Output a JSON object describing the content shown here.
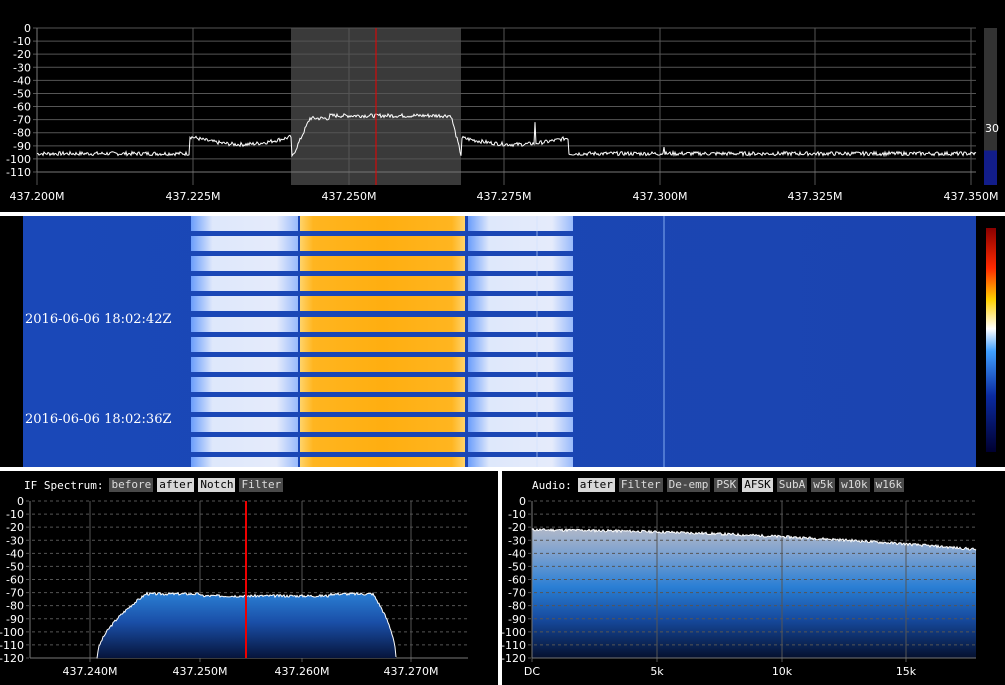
{
  "top_spectrum": {
    "y_ticks": [
      "0",
      "-10",
      "-20",
      "-30",
      "-40",
      "-50",
      "-60",
      "-70",
      "-80",
      "-90",
      "-100",
      "-110"
    ],
    "x_ticks": [
      "437.200M",
      "437.225M",
      "437.250M",
      "437.275M",
      "437.300M",
      "437.325M",
      "437.350M"
    ],
    "level_value": "30"
  },
  "waterfall": {
    "timestamps": [
      "2016-06-06 18:02:42Z",
      "2016-06-06 18:02:36Z"
    ]
  },
  "if_panel": {
    "title": "IF Spectrum:",
    "buttons": [
      {
        "label": "before",
        "active": false
      },
      {
        "label": "after",
        "active": true
      },
      {
        "label": "Notch",
        "active": true
      },
      {
        "label": "Filter",
        "active": false
      }
    ],
    "y_ticks": [
      "0",
      "-10",
      "-20",
      "-30",
      "-40",
      "-50",
      "-60",
      "-70",
      "-80",
      "-90",
      "-100",
      "-110",
      "-120"
    ],
    "x_ticks": [
      "437.240M",
      "437.250M",
      "437.260M",
      "437.270M"
    ]
  },
  "audio_panel": {
    "title": "Audio:",
    "buttons": [
      {
        "label": "after",
        "active": true
      },
      {
        "label": "Filter",
        "active": false
      },
      {
        "label": "De-emp",
        "active": false
      },
      {
        "label": "PSK",
        "active": false
      },
      {
        "label": "AFSK",
        "active": true
      },
      {
        "label": "SubA",
        "active": false
      },
      {
        "label": "w5k",
        "active": false
      },
      {
        "label": "w10k",
        "active": false
      },
      {
        "label": "w16k",
        "active": false
      }
    ],
    "y_ticks": [
      "0",
      "-10",
      "-20",
      "-30",
      "-40",
      "-50",
      "-60",
      "-70",
      "-80",
      "-90",
      "-100",
      "-110",
      "-120"
    ],
    "x_ticks": [
      "DC",
      "5k",
      "10k",
      "15k"
    ]
  }
}
